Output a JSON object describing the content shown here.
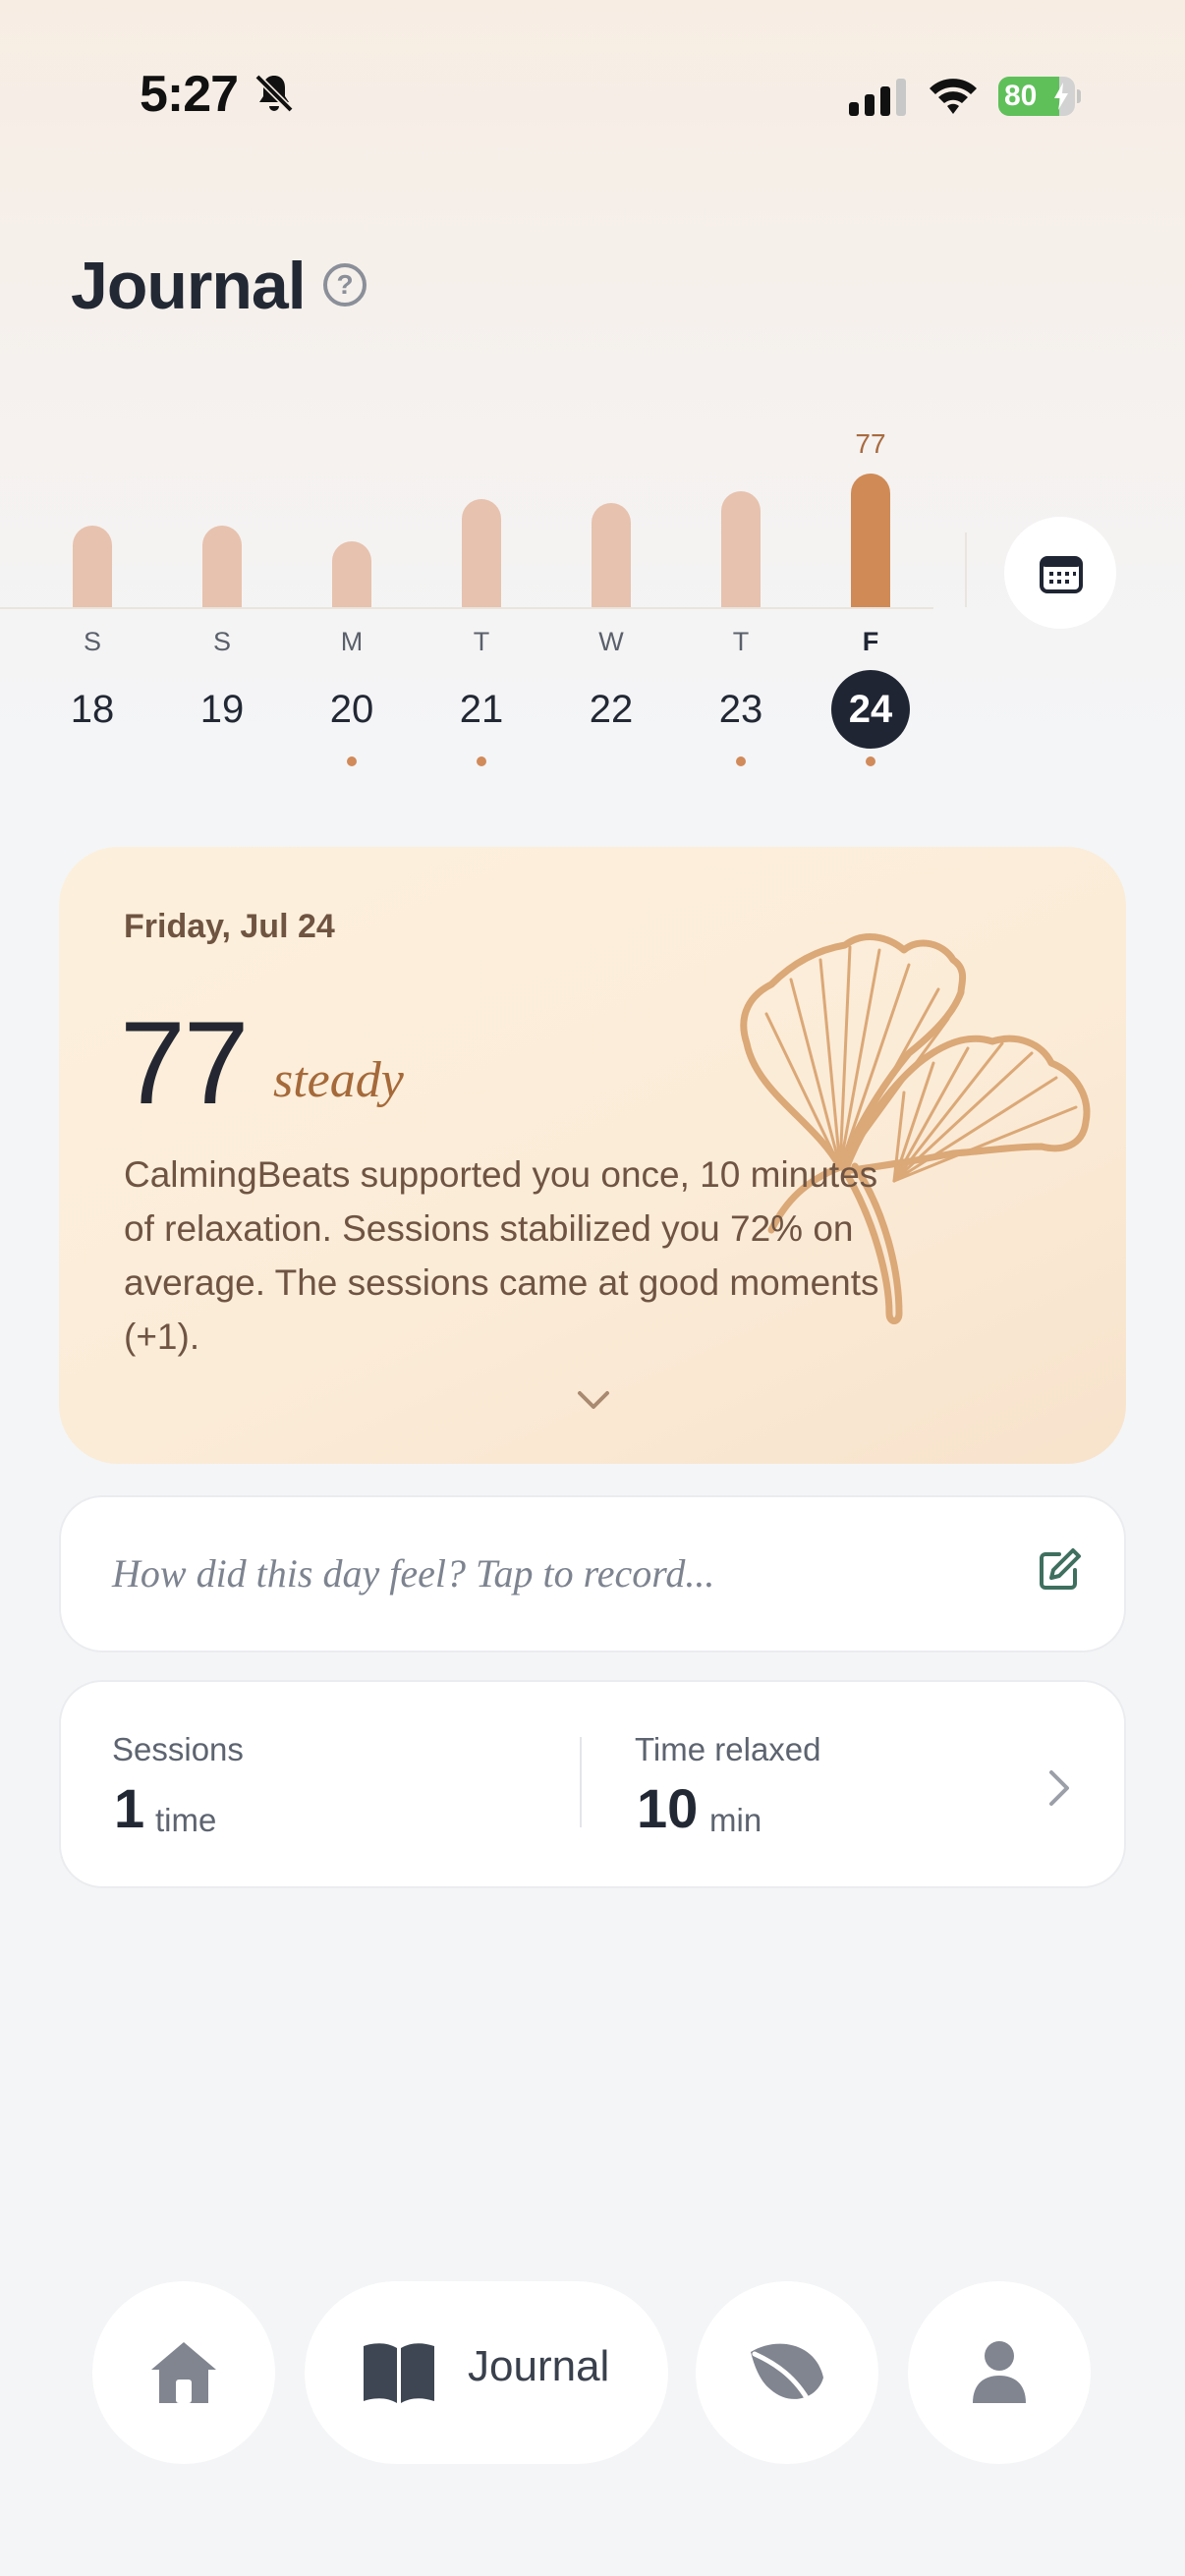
{
  "status_bar": {
    "time": "5:27",
    "battery_percent": "80",
    "battery_level": 0.8,
    "icons": [
      "bell-slash-icon",
      "cellular-signal-icon",
      "wifi-icon",
      "battery-charging-icon"
    ]
  },
  "header": {
    "title": "Journal",
    "help_icon": "?"
  },
  "week": {
    "days": [
      {
        "letter": "S",
        "date": "18",
        "score": 47,
        "has_entry": false,
        "selected": false
      },
      {
        "letter": "S",
        "date": "19",
        "score": 47,
        "has_entry": false,
        "selected": false
      },
      {
        "letter": "M",
        "date": "20",
        "score": 38,
        "has_entry": true,
        "selected": false
      },
      {
        "letter": "T",
        "date": "21",
        "score": 62,
        "has_entry": true,
        "selected": false
      },
      {
        "letter": "W",
        "date": "22",
        "score": 60,
        "has_entry": false,
        "selected": false
      },
      {
        "letter": "T",
        "date": "23",
        "score": 67,
        "has_entry": true,
        "selected": false
      },
      {
        "letter": "F",
        "date": "24",
        "score": 77,
        "has_entry": true,
        "selected": true
      }
    ],
    "selected_value_label": "77",
    "colors": {
      "bar": "#e7c2ae",
      "bar_selected": "#d08a56",
      "dot": "#d18a5a"
    }
  },
  "summary": {
    "date": "Friday, Jul 24",
    "score": "77",
    "mood": "steady",
    "text": "CalmingBeats supported you once, 10 minutes of relaxation. Sessions stabilized you 72% on average. The sessions came at good moments (+1)."
  },
  "note": {
    "placeholder": "How did this day feel? Tap to record..."
  },
  "stats": {
    "sessions_label": "Sessions",
    "sessions_value": "1",
    "sessions_unit": "time",
    "time_label": "Time relaxed",
    "time_value": "10",
    "time_unit": "min"
  },
  "nav": {
    "journal_label": "Journal",
    "items": [
      "home-icon",
      "journal-book-icon",
      "leaf-icon",
      "profile-icon"
    ]
  },
  "colors": {
    "accent": "#d08a56",
    "dark": "#1f2533",
    "card": "#fbecd8"
  }
}
